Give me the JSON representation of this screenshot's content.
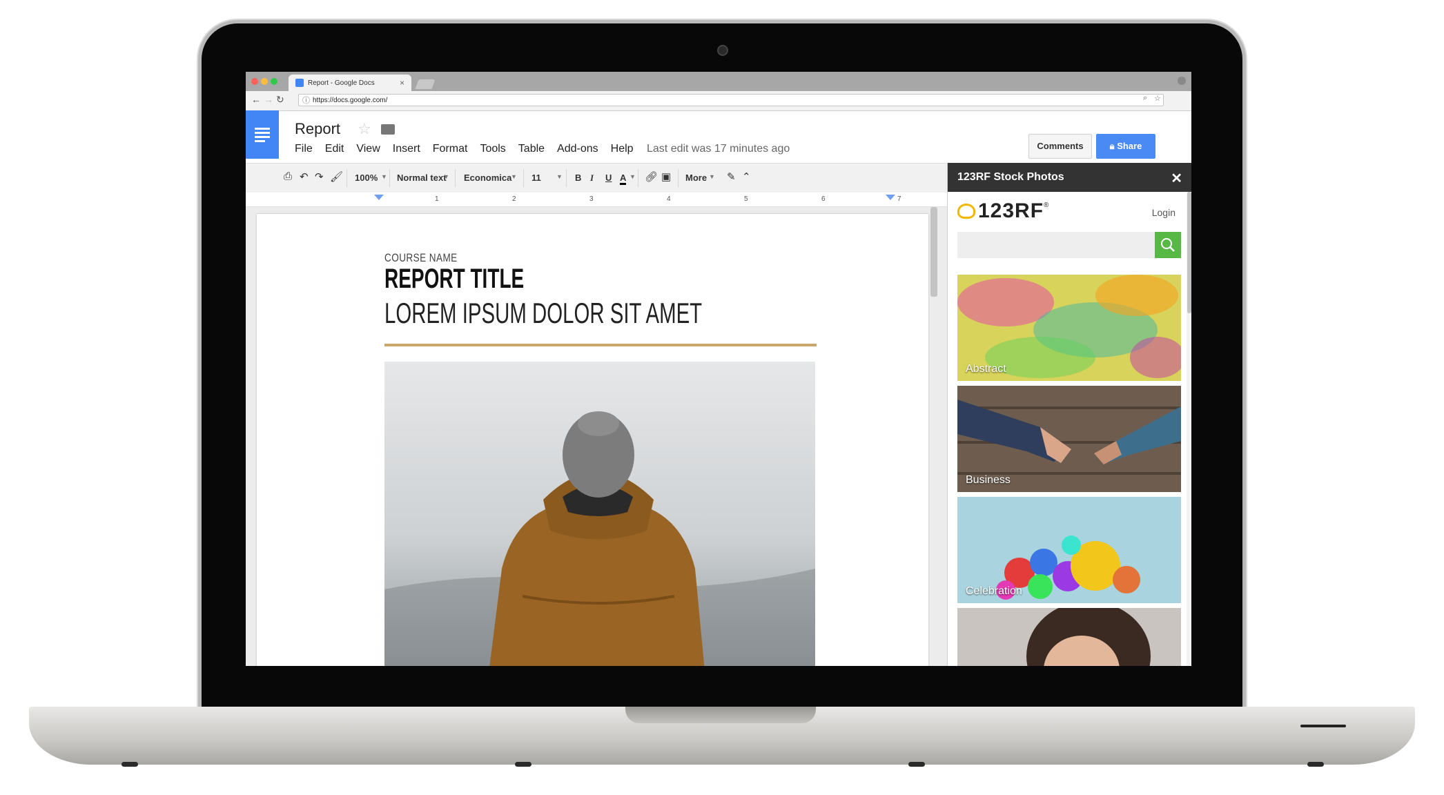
{
  "browser": {
    "tab_title": "Report - Google Docs",
    "tab_close": "×",
    "url": "https://docs.google.com/"
  },
  "docs": {
    "title": "Report",
    "menu": [
      "File",
      "Edit",
      "View",
      "Insert",
      "Format",
      "Tools",
      "Table",
      "Add-ons",
      "Help"
    ],
    "last_edit": "Last edit was 17 minutes ago",
    "comments_label": "Comments",
    "share_label": "Share"
  },
  "toolbar": {
    "zoom": "100%",
    "style": "Normal text",
    "font": "Economica",
    "size": "11",
    "bold": "B",
    "italic": "I",
    "underline": "U",
    "text_color": "A",
    "more": "More"
  },
  "ruler": [
    "1",
    "2",
    "3",
    "4",
    "5",
    "6",
    "7"
  ],
  "document": {
    "course_name": "COURSE NAME",
    "report_title": "REPORT TITLE",
    "subtitle": "LOREM IPSUM DOLOR SIT AMET",
    "accent_color": "#c9a66b"
  },
  "side_panel": {
    "title": "123RF Stock Photos",
    "close": "✕",
    "logo": "123RF",
    "logo_mark": "®",
    "login": "Login",
    "categories": [
      "Abstract",
      "Business",
      "Celebration"
    ]
  }
}
